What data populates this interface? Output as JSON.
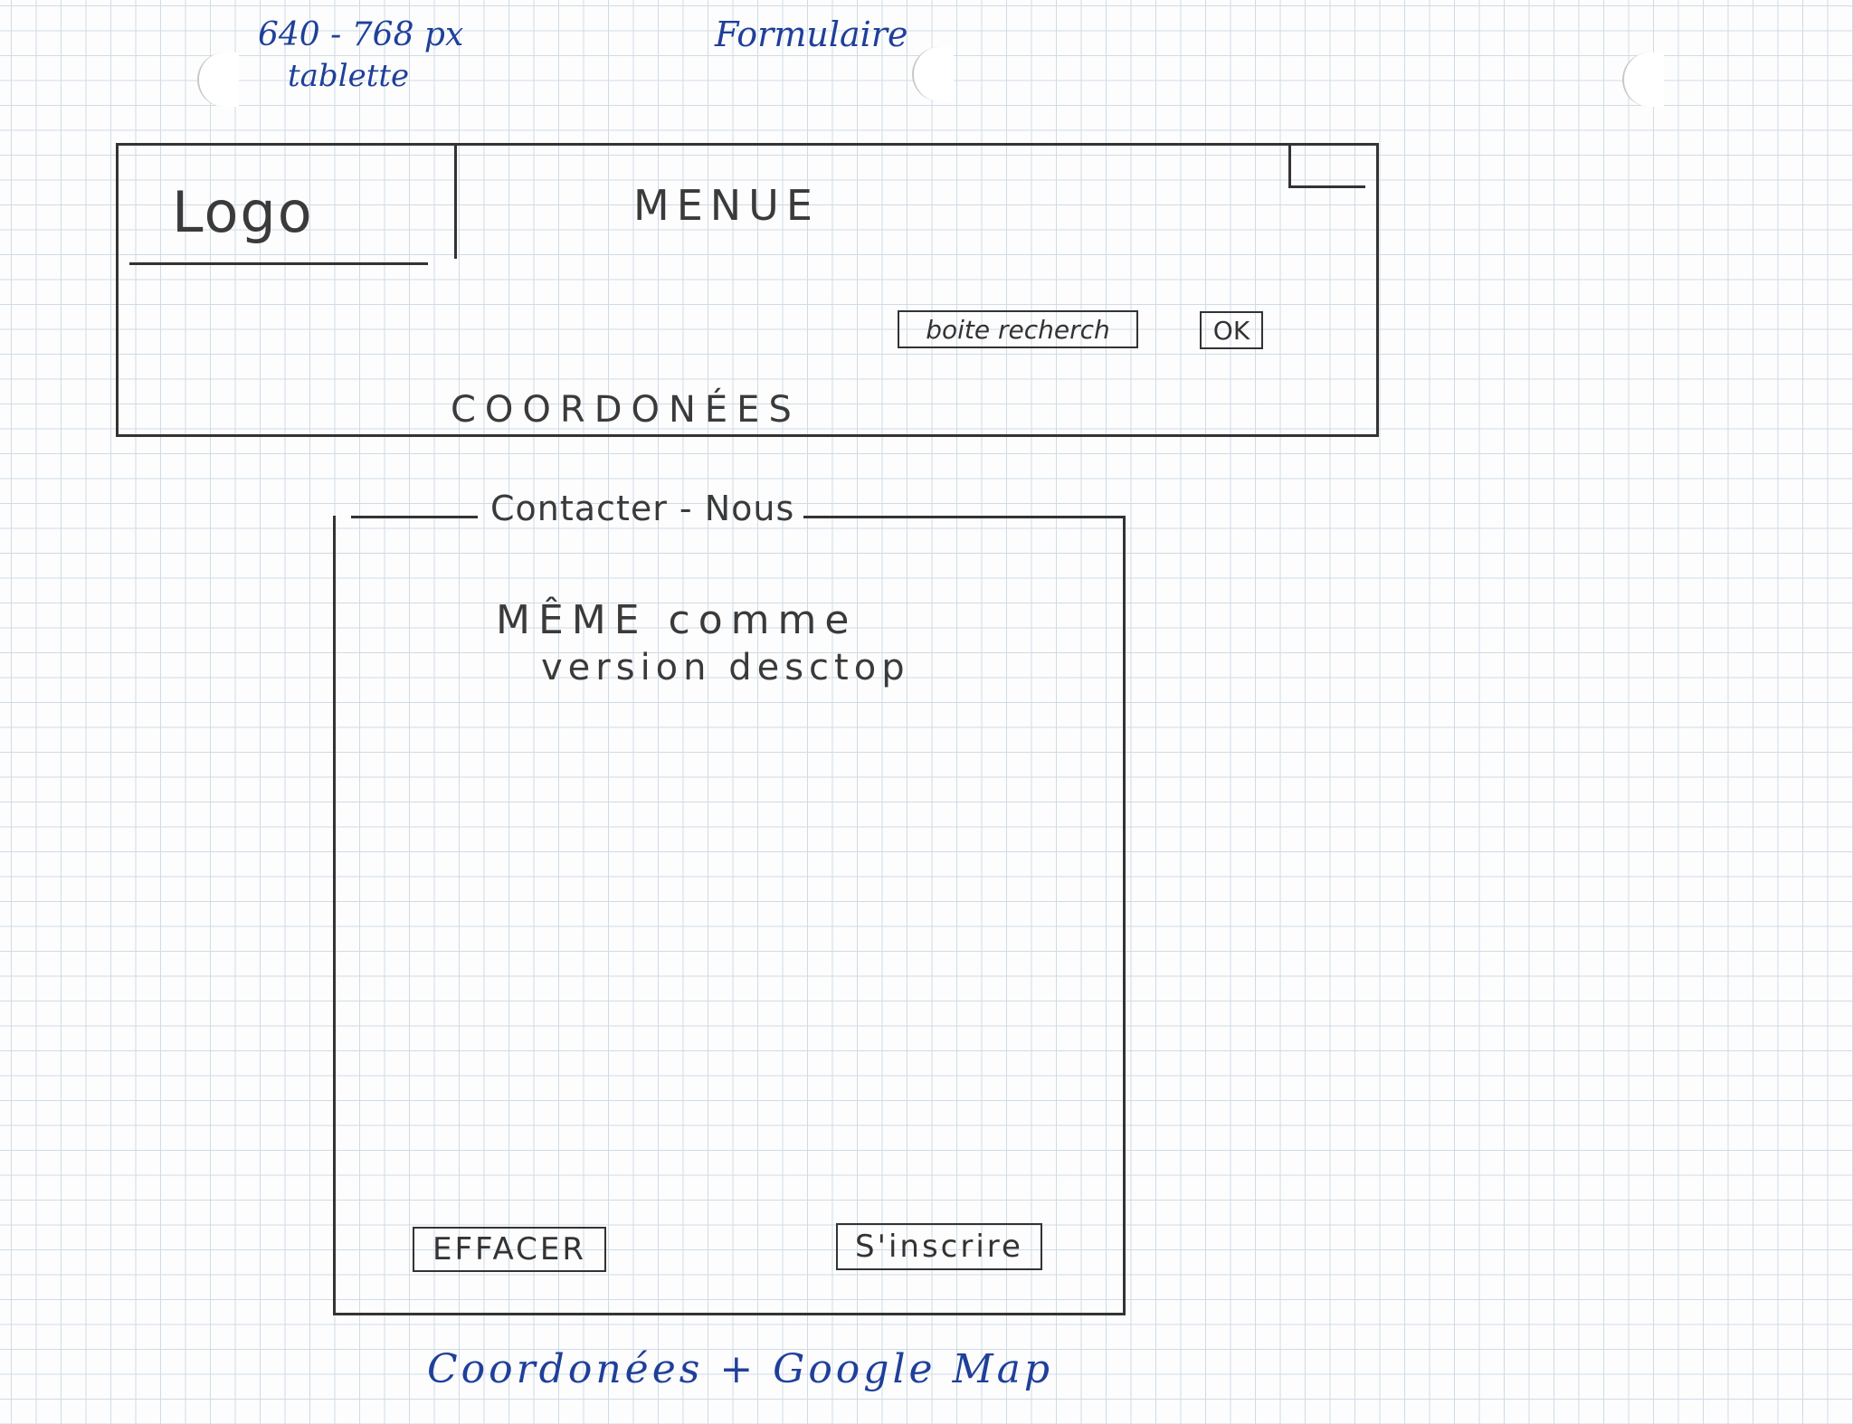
{
  "notes": {
    "dimensions": "640 - 768 px",
    "device": "tablette",
    "page_title": "Formulaire"
  },
  "header": {
    "logo": "Logo",
    "menu": "MENUE",
    "search_box": "boite recherch",
    "ok_button": "OK",
    "coordonnees": "COORDONÉES"
  },
  "form": {
    "legend": "Contacter - Nous",
    "note_line1": "MÊME comme",
    "note_line2": "version desctop",
    "clear_button": "EFFACER",
    "subscribe_button": "S'inscrire"
  },
  "footer": {
    "note": "Coordonées + Google Map"
  }
}
